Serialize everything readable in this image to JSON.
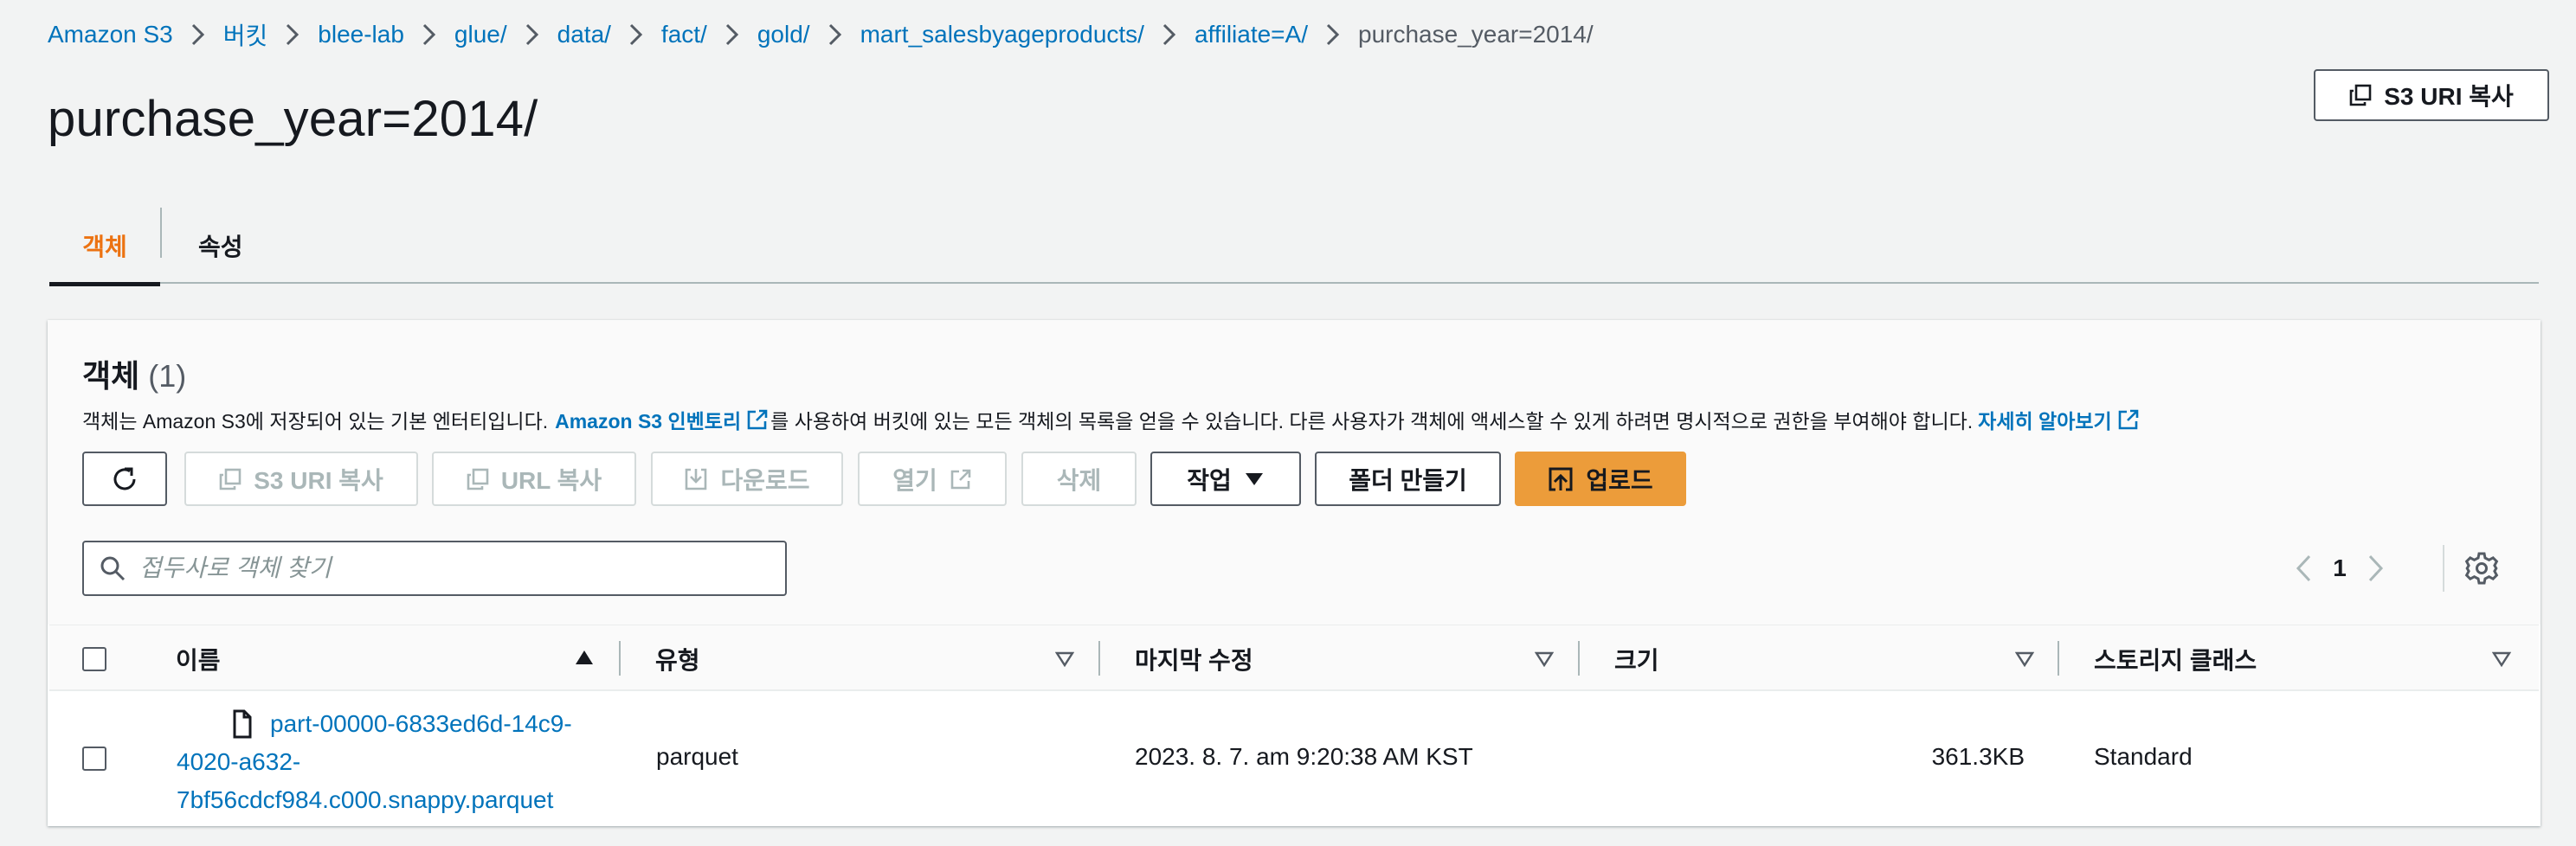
{
  "breadcrumb": [
    {
      "label": "Amazon S3"
    },
    {
      "label": "버킷"
    },
    {
      "label": "blee-lab"
    },
    {
      "label": "glue/"
    },
    {
      "label": "data/"
    },
    {
      "label": "fact/"
    },
    {
      "label": "gold/"
    },
    {
      "label": "mart_salesbyageproducts/"
    },
    {
      "label": "affiliate=A/"
    },
    {
      "label": "purchase_year=2014/"
    }
  ],
  "page": {
    "title": "purchase_year=2014/",
    "copy_uri_label": "S3 URI 복사"
  },
  "tabs": [
    {
      "label": "객체",
      "active": true
    },
    {
      "label": "속성",
      "active": false
    }
  ],
  "objects": {
    "title": "객체",
    "count": "(1)",
    "description_1": "객체는 Amazon S3에 저장되어 있는 기본 엔터티입니다.",
    "inventory_link": "Amazon S3 인벤토리",
    "description_2": "를 사용하여 버킷에 있는 모든 객체의 목록을 얻을 수 있습니다. 다른 사용자가 객체에 액세스할 수 있게 하려면 명시적으로 권한을 부여해야 합니다.",
    "learn_more": "자세히 알아보기",
    "toolbar": {
      "copy_uri": "S3 URI 복사",
      "copy_url": "URL 복사",
      "download": "다운로드",
      "open": "열기",
      "delete": "삭제",
      "actions": "작업",
      "create_folder": "폴더 만들기",
      "upload": "업로드"
    },
    "search_placeholder": "접두사로 객체 찾기",
    "page_number": "1",
    "columns": [
      "이름",
      "유형",
      "마지막 수정",
      "크기",
      "스토리지 클래스"
    ],
    "rows": [
      {
        "name_lines": [
          "part-00000-6833ed6d-14c9-",
          "4020-a632-",
          "7bf56cdcf984.c000.snappy.parquet"
        ],
        "type": "parquet",
        "last_modified": "2023. 8. 7. am 9:20:38 AM KST",
        "size": "361.3KB",
        "storage_class": "Standard"
      }
    ]
  },
  "colors": {
    "link": "#0073bb",
    "accent": "#ec7211",
    "primary_button": "#ec9c3a",
    "disabled": "#aab7b8"
  },
  "icons": [
    "chevron-right-icon",
    "copy-icon",
    "refresh-icon",
    "download-icon",
    "external-link-icon",
    "caret-down-icon",
    "upload-icon",
    "search-icon",
    "chevron-left-icon",
    "gear-icon",
    "file-icon",
    "sort-ascending-icon",
    "sort-descending-icon"
  ]
}
